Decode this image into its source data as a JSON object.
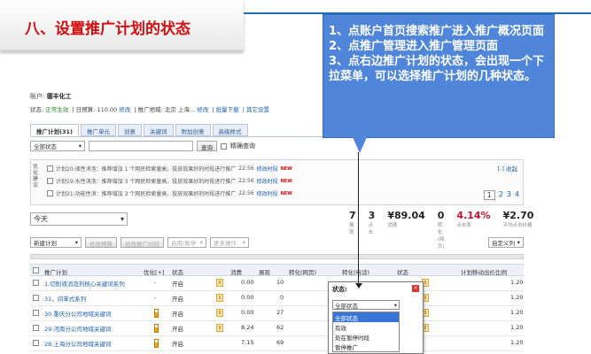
{
  "slide": {
    "title": "八、设置推广计划的状态",
    "callout": "1、点账户首页搜索推广进入推广概况页面\n2、点推广管理进入推广管理页面\n3、点右边推广计划的状态，会出现一个下拉菜单，可以选择推广计划的几种状态。"
  },
  "account": {
    "prefix": "账户:",
    "name": "德丰化工",
    "status_label": "状态:",
    "status_value": "正常生效",
    "budget": "日预算: 110.00",
    "budget_edit": "修改",
    "region": "推广地域: 北京 上海...",
    "region_edit": "修改",
    "batch_download": "批量下载",
    "other_settings": "其它设置"
  },
  "tabs": [
    {
      "label": "推广计划",
      "count": "(31)"
    },
    {
      "label": "推广单元"
    },
    {
      "label": "创意"
    },
    {
      "label": "关键词"
    },
    {
      "label": "附加创意"
    },
    {
      "label": "高级样式"
    }
  ],
  "filter": {
    "select_value": "全部状态",
    "query_button": "查询",
    "exact_label": "精确查询"
  },
  "suggestions": {
    "side_label": "优化建议",
    "collapse": "[-] 收起",
    "items": [
      {
        "text": "计划20:液性消泡：推荐增加 1 个网民检索量高，投放效果好的时段进行推广",
        "time": "22:56",
        "action": "修改时段",
        "badge": "NEW"
      },
      {
        "text": "计划19:水性消泡：推荐增加 3 个网民检索量高，投放效果好的时段进行推广",
        "time": "22:56",
        "action": "修改时段",
        "badge": "NEW"
      },
      {
        "text": "计划21:功能性消：推荐增加 3 个网民检索量高，投放效果好的时段进行推广",
        "time": "22:56",
        "action": "修改时段",
        "badge": "NEW"
      }
    ],
    "pages": [
      "1",
      "2",
      "3",
      "4"
    ]
  },
  "date_select": "今天",
  "stats": [
    {
      "value": "7",
      "label": "展现"
    },
    {
      "value": "3",
      "label": "点击"
    },
    {
      "value": "¥89.04",
      "label": "消费"
    },
    {
      "value": "0",
      "label": "转化(网页)"
    },
    {
      "value": "4.14%",
      "label": "点击率"
    },
    {
      "value": "¥2.70",
      "label": "平均点击价格"
    }
  ],
  "toolbar": {
    "new_plan": "新建计划",
    "edit_budget": "修改预算",
    "edit_schedule": "修改推广时段",
    "enable_pause": "启用/暂停",
    "more_ops": "更多操作",
    "custom_columns": "自定义列"
  },
  "table": {
    "headers": {
      "name": "推广计划",
      "priority": "优化[+]",
      "status": "状态",
      "budget": "消费",
      "impr": "展现",
      "conv": "转化(网页)",
      "conv_phone": "转化(电话)",
      "state": "状态",
      "mobile_ratio": "计划移动出价比例"
    },
    "rows": [
      {
        "name": "1.切削液消泡剂核心关键词系列",
        "prio": "-",
        "status": "开启",
        "cost": "0.00",
        "impr": "10",
        "ratio": "1.20"
      },
      {
        "name": "31，间苯式系列",
        "prio": "-",
        "status": "开启",
        "cost": "0.00",
        "impr": "0",
        "ratio": "1.20"
      },
      {
        "name": "30.重庆分公司地域关键词",
        "prio": "",
        "status": "开启",
        "cost": "0.00",
        "impr": "27",
        "ratio": "1.20"
      },
      {
        "name": "29.河南分公司地域关键词",
        "prio": "",
        "status": "开启",
        "cost": "8.24",
        "impr": "62",
        "ratio": "1.20"
      },
      {
        "name": "28.上海分公司地域关键词",
        "prio": "",
        "status": "开启",
        "cost": "7.15",
        "impr": "69",
        "ratio": "1.20"
      }
    ]
  },
  "dropdown": {
    "header": "状态:",
    "close": "×",
    "selected": "全部状态",
    "options": [
      "全部状态",
      "有效",
      "处在暂停时段",
      "暂停推广"
    ]
  },
  "colors": {
    "title_red": "#d01010",
    "callout_blue": "#4f86d9",
    "link_blue": "#1a5fb4",
    "rule_blue": "#1f6fc1"
  }
}
